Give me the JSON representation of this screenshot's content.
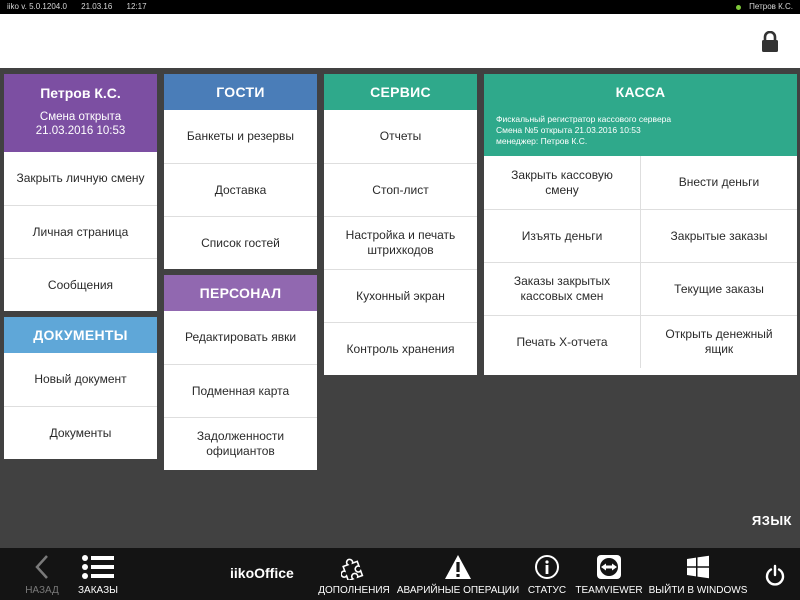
{
  "statusbar": {
    "version": "iiko v. 5.0.1204.0",
    "date": "21.03.16",
    "time": "12:17",
    "user": "Петров К.С."
  },
  "colors": {
    "user": "#7c4fa2",
    "guests": "#4a7db8",
    "service": "#2fa98b",
    "kassa": "#2fa98b",
    "personnel": "#9168b0",
    "documents": "#5fa7d8"
  },
  "user_panel": {
    "name": "Петров К.С.",
    "shift_line1": "Смена открыта",
    "shift_line2": "21.03.2016 10:53",
    "items": [
      "Закрыть личную смену",
      "Личная страница",
      "Сообщения"
    ]
  },
  "documents": {
    "title": "ДОКУМЕНТЫ",
    "items": [
      "Новый документ",
      "Документы"
    ]
  },
  "guests": {
    "title": "ГОСТИ",
    "items": [
      "Банкеты и резервы",
      "Доставка",
      "Список гостей"
    ]
  },
  "personnel": {
    "title": "ПЕРСОНАЛ",
    "items": [
      "Редактировать явки",
      "Подменная карта",
      "Задолженности официантов"
    ]
  },
  "service": {
    "title": "СЕРВИС",
    "items": [
      "Отчеты",
      "Стоп-лист",
      "Настройка и печать штрихкодов",
      "Кухонный экран",
      "Контроль хранения"
    ]
  },
  "kassa": {
    "title": "КАССА",
    "info1": "Фискальный регистратор кассового сервера",
    "info2": "Смена №5 открыта 21.03.2016 10:53",
    "info3": "менеджер: Петров К.С.",
    "items": [
      "Закрыть кассовую смену",
      "Внести деньги",
      "Изъять деньги",
      "Закрытые заказы",
      "Заказы закрытых кассовых смен",
      "Текущие заказы",
      "Печать X-отчета",
      "Открыть денежный ящик"
    ]
  },
  "language_label": "ЯЗЫК",
  "toolbar": {
    "back": "НАЗАД",
    "orders": "ЗАКАЗЫ",
    "brand": "iikoOffice",
    "addons": "ДОПОЛНЕНИЯ",
    "emergency": "АВАРИЙНЫЕ ОПЕРАЦИИ",
    "status": "СТАТУС",
    "teamviewer": "TEAMVIEWER",
    "exit_windows": "ВЫЙТИ В WINDOWS"
  },
  "icons": {
    "lock": "lock-icon",
    "back": "chevron-left-icon",
    "orders": "list-icon",
    "addons": "puzzle-icon",
    "emergency": "warning-icon",
    "status": "info-icon",
    "teamviewer": "teamviewer-icon",
    "exit_windows": "windows-icon",
    "power": "power-icon"
  }
}
